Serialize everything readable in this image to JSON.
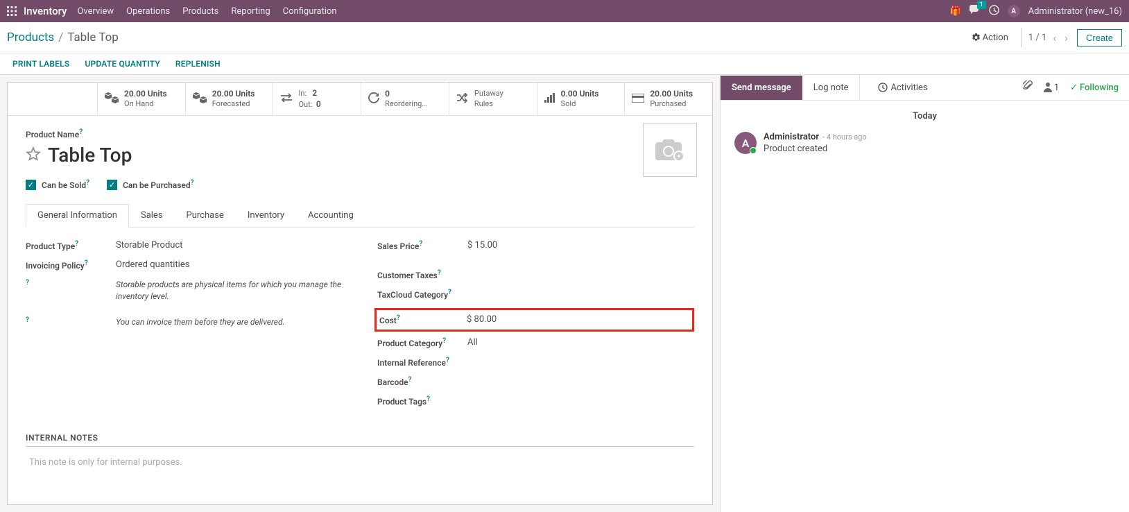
{
  "topbar": {
    "app_name": "Inventory",
    "menu": [
      "Overview",
      "Operations",
      "Products",
      "Reporting",
      "Configuration"
    ],
    "chat_badge": "1",
    "user_initial": "A",
    "user_name": "Administrator (new_16)"
  },
  "breadcrumb": {
    "link": "Products",
    "active": "Table Top"
  },
  "control": {
    "action": "Action",
    "pager": "1 / 1",
    "create": "Create"
  },
  "subnav": [
    "PRINT LABELS",
    "UPDATE QUANTITY",
    "REPLENISH"
  ],
  "stats": {
    "onhand_value": "20.00",
    "onhand_units": "Units",
    "onhand_label": "On Hand",
    "forecast_value": "20.00",
    "forecast_units": "Units",
    "forecast_label": "Forecasted",
    "in_label": "In:",
    "in_value": "2",
    "out_label": "Out:",
    "out_value": "0",
    "reorder_value": "0",
    "reorder_label": "Reordering…",
    "putaway_label1": "Putaway",
    "putaway_label2": "Rules",
    "sold_value": "0.00",
    "sold_units": "Units",
    "sold_label": "Sold",
    "purchased_value": "20.00",
    "purchased_units": "Units",
    "purchased_label": "Purchased"
  },
  "product": {
    "name_label": "Product Name",
    "title": "Table Top",
    "can_be_sold": "Can be Sold",
    "can_be_purchased": "Can be Purchased"
  },
  "tabs": [
    "General Information",
    "Sales",
    "Purchase",
    "Inventory",
    "Accounting"
  ],
  "fields": {
    "product_type_label": "Product Type",
    "product_type_value": "Storable Product",
    "invoicing_policy_label": "Invoicing Policy",
    "invoicing_policy_value": "Ordered quantities",
    "help1": "Storable products are physical items for which you manage the inventory level.",
    "help2": "You can invoice them before they are delivered.",
    "sales_price_label": "Sales Price",
    "sales_price_value": "$ 15.00",
    "customer_taxes_label": "Customer Taxes",
    "taxcloud_label": "TaxCloud Category",
    "cost_label": "Cost",
    "cost_value": "$ 80.00",
    "product_category_label": "Product Category",
    "product_category_value": "All",
    "internal_ref_label": "Internal Reference",
    "barcode_label": "Barcode",
    "product_tags_label": "Product Tags",
    "internal_notes_heading": "INTERNAL NOTES",
    "internal_notes_placeholder": "This note is only for internal purposes."
  },
  "chatter": {
    "send_message": "Send message",
    "log_note": "Log note",
    "activities": "Activities",
    "followers_count": "1",
    "following": "Following",
    "today": "Today",
    "msg_author": "Administrator",
    "msg_time": "- 4 hours ago",
    "msg_body": "Product created",
    "avatar_initial": "A"
  }
}
